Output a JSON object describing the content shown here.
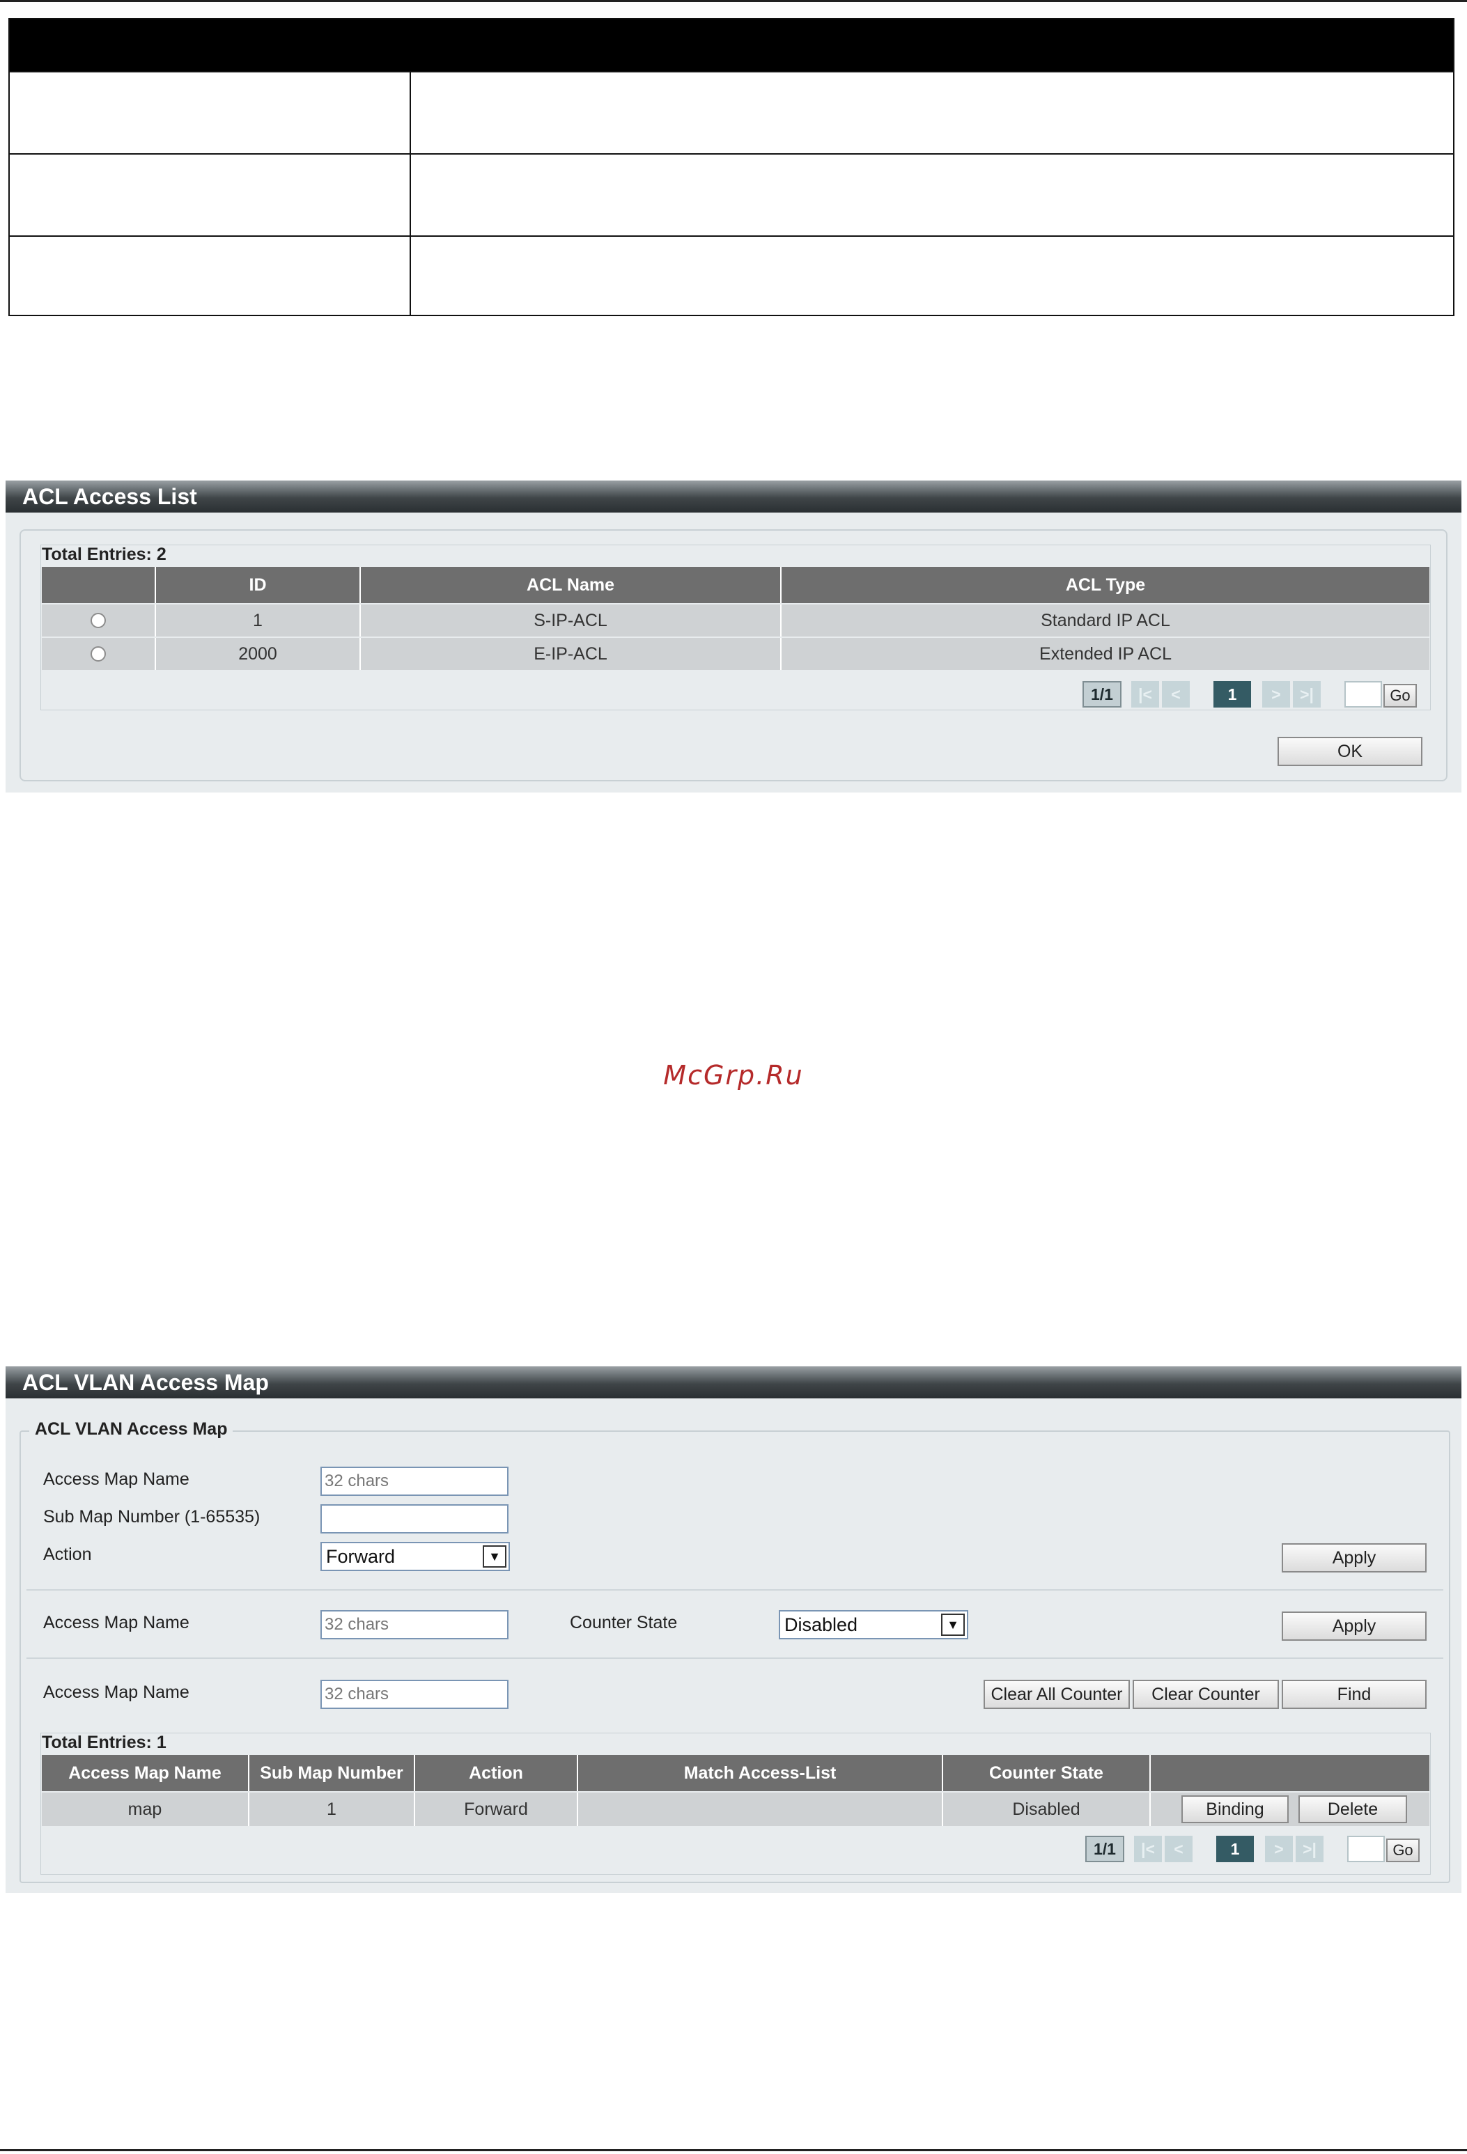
{
  "acl_access_list": {
    "title": "ACL Access List",
    "total_entries": "Total Entries: 2",
    "columns": [
      "ID",
      "ACL Name",
      "ACL Type"
    ],
    "rows": [
      {
        "id": "1",
        "name": "S-IP-ACL",
        "type": "Standard IP ACL"
      },
      {
        "id": "2000",
        "name": "E-IP-ACL",
        "type": "Extended IP ACL"
      }
    ],
    "pagination": {
      "total": "1/1",
      "first": "|<",
      "prev": "<",
      "current": "1",
      "next": ">",
      "last": ">|",
      "go": "Go"
    },
    "ok_label": "OK"
  },
  "watermark": "McGrp.Ru",
  "acl_vlan_access_map": {
    "title": "ACL VLAN Access Map",
    "fieldset_legend": "ACL VLAN Access Map",
    "form1": {
      "access_map_name_label": "Access Map Name",
      "access_map_name_placeholder": "32 chars",
      "sub_map_label": "Sub Map Number (1-65535)",
      "sub_map_value": "",
      "action_label": "Action",
      "action_value": "Forward",
      "apply_label": "Apply"
    },
    "form2": {
      "access_map_name_label": "Access Map Name",
      "access_map_name_placeholder": "32 chars",
      "counter_state_label": "Counter State",
      "counter_state_value": "Disabled",
      "apply_label": "Apply"
    },
    "form3": {
      "access_map_name_label": "Access Map Name",
      "access_map_name_placeholder": "32 chars",
      "clear_all_label": "Clear All Counter",
      "clear_label": "Clear Counter",
      "find_label": "Find"
    },
    "total_entries": "Total Entries: 1",
    "columns": [
      "Access Map Name",
      "Sub Map Number",
      "Action",
      "Match Access-List",
      "Counter State",
      ""
    ],
    "rows": [
      {
        "name": "map",
        "sub_map": "1",
        "action": "Forward",
        "match": "",
        "counter_state": "Disabled",
        "binding_label": "Binding",
        "delete_label": "Delete"
      }
    ],
    "pagination": {
      "total": "1/1",
      "first": "|<",
      "prev": "<",
      "current": "1",
      "next": ">",
      "last": ">|",
      "go": "Go"
    }
  }
}
